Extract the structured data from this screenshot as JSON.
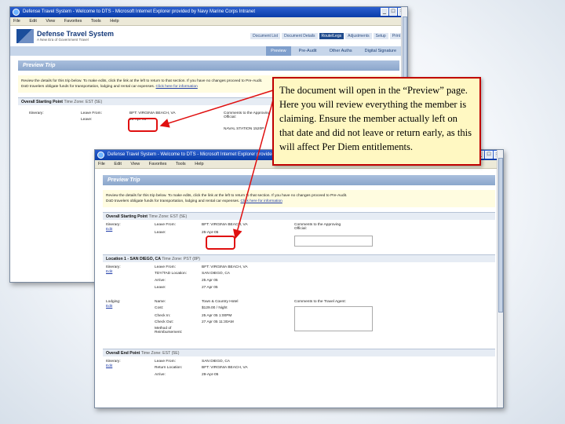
{
  "browser": {
    "title": "Defense Travel System - Welcome to DTS - Microsoft Internet Explorer provided by Navy Marine Corps Intranet",
    "controls": [
      "_",
      "□",
      "×"
    ],
    "menu": [
      "File",
      "Edit",
      "View",
      "Favorites",
      "Tools",
      "Help"
    ]
  },
  "site": {
    "name": "Defense Travel System",
    "tagline": "A New Era of Government Travel",
    "tabs": [
      "Document List",
      "Document Details",
      "Route/Legs",
      "Adjustments",
      "Setup",
      "Print"
    ],
    "subnav": [
      "Preview",
      "Pre-Audit",
      "Other Auths",
      "Digital Signature"
    ]
  },
  "page": {
    "title": "Preview Trip",
    "note_line1": "Review the details for this trip below. To make edits, click the link at the left to return to that section. If you have no changes proceed to Pre-Audit.",
    "note_line2": "DoD travelers obligate funds for transportation, lodging and rental car expenses.",
    "note_link": "Click here for information",
    "sections": [
      {
        "heading": "Overall Starting Point",
        "timezone": "Time Zone: EST (5E)"
      },
      {
        "heading": "Location 1 - SAN DIEGO, CA",
        "timezone": "Time Zone: PST (8P)"
      },
      {
        "heading": "Overall End Point",
        "timezone": "Time Zone: EST (5E)"
      }
    ],
    "start": {
      "itinerary_label": "Itinerary:",
      "edit": "Edit",
      "leave_from_label": "Leave From:",
      "leave_from": "BFT: VIRGINIA BEACH, VA",
      "leave_label": "Leave:",
      "leave_date": "25-Apr-05",
      "comments_label": "Comments to the Approving Official:"
    },
    "location": {
      "itinerary_label": "Itinerary:",
      "edit": "Edit",
      "leave_from_label": "Leave From:",
      "leave_from": "BFT: VIRGINIA BEACH, VA",
      "tdy_label": "TDY/TAD Location:",
      "tdy": "SAN DIEGO, CA",
      "arrive_label": "Arrive:",
      "arrive": "25 Apr 05",
      "leave_label": "Leave:",
      "leave": "27 Apr 05",
      "lodging_label": "Lodging:",
      "name_label": "Name:",
      "name": "Town & Country Hotel",
      "cost_label": "Cost:",
      "cost": "$129.00 / Night",
      "checkin_label": "Check In:",
      "checkin": "25 Apr 05   1:00PM",
      "checkout_label": "Check Out:",
      "checkout": "27 Apr 05   11:30AM",
      "method_label": "Method of Reimbursement:",
      "comments_label": "Comments to the Travel Agent:"
    },
    "end": {
      "itinerary_label": "Itinerary:",
      "edit": "Edit",
      "leave_from_label": "Leave From:",
      "leave_from": "SAN DIEGO, CA",
      "return_label": "Return Location:",
      "return_to": "BFT: VIRGINIA BEACH, VA",
      "arrive_label": "Arrive:",
      "arrive": "29-Apr-05"
    }
  },
  "back_window": {
    "leave_label": "Leave:",
    "leave_date": "25-Apr-05",
    "comments_label": "Comments to the Approving Official:",
    "naval_station": "NAVAL STATION 1520P"
  },
  "callout": {
    "text": "The document will open in the “Preview” page. Here you will review everything the member is claiming. Ensure the member actually left on that date and did not leave or return early, as this will affect Per Diem entitlements."
  },
  "colors": {
    "highlight": "#e01010",
    "callout_border": "#c00000",
    "callout_bg": "#fff8c2",
    "titlebar": "#0a3da8"
  }
}
